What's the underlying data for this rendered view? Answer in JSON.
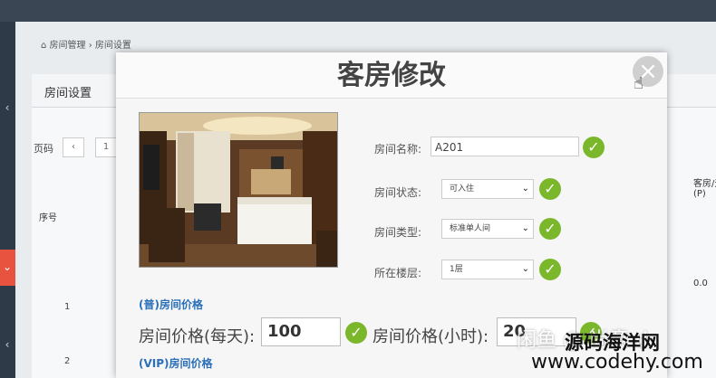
{
  "breadcrumb": "房间管理 › 房间设置",
  "panel": {
    "title": "房间设置"
  },
  "pager": {
    "label": "页码",
    "prev": "‹",
    "page": "1"
  },
  "table": {
    "col_no": "序号",
    "rows": [
      "1",
      "2"
    ],
    "right_header": "客房/天\n(P)",
    "right_cell": "0.0"
  },
  "modal": {
    "title": "客房修改",
    "close": "×",
    "fields": {
      "name_label": "房间名称:",
      "name_value": "A201",
      "status_label": "房间状态:",
      "status_value": "可入住",
      "type_label": "房间类型:",
      "type_value": "标准单人间",
      "floor_label": "所在楼层:",
      "floor_value": "1层"
    },
    "sections": {
      "normal_price": "(普)房间价格",
      "vip_price": "(VIP)房间价格"
    },
    "prices": {
      "daily_label": "房间价格(每天):",
      "daily_value": "100",
      "hourly_label": "房间价格(小时):",
      "hourly_value": "20"
    }
  },
  "watermark": {
    "line1": "闲鱼 @ 尚意 dr",
    "line2": "源码海洋网",
    "line3": "www.codehy.com"
  },
  "colors": {
    "check": "#7ab72a",
    "section": "#2a6fba",
    "active_nav": "#e8533f"
  }
}
